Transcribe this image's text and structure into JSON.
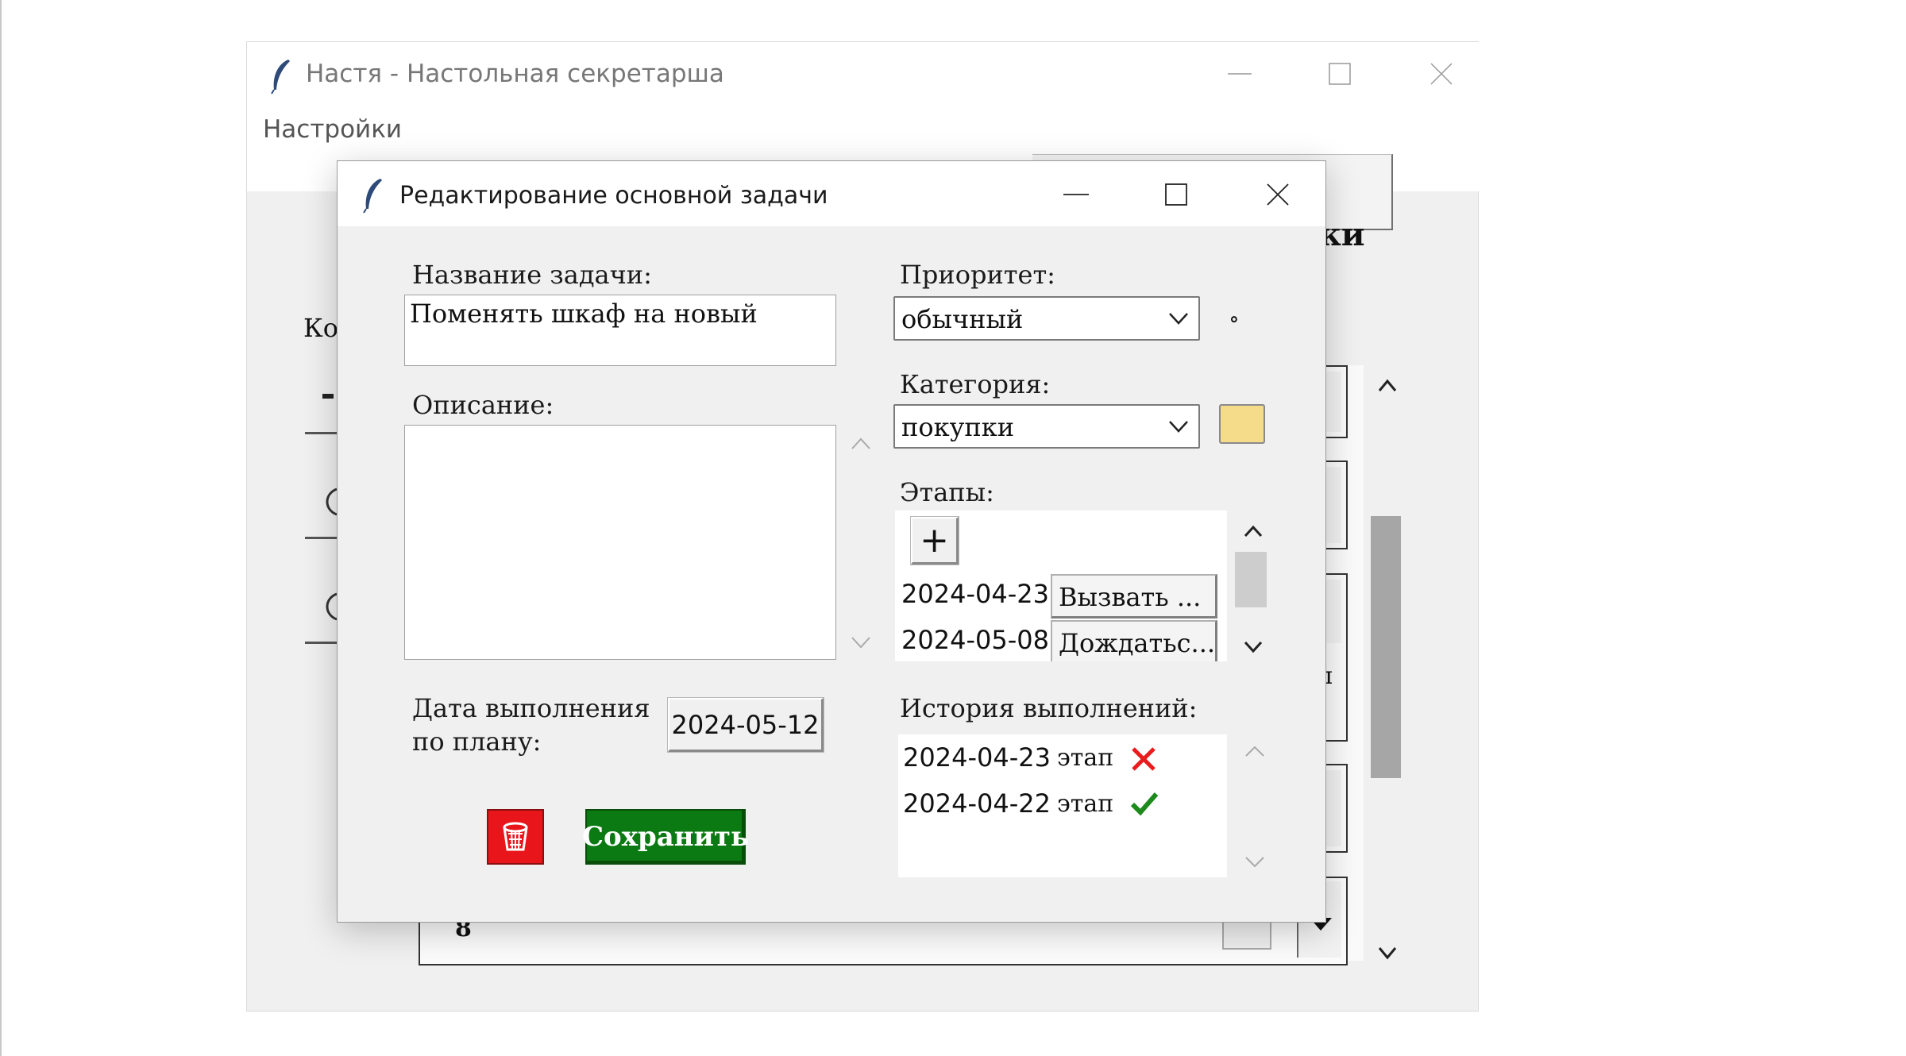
{
  "main_window": {
    "title": "Настя - Настольная секретарша",
    "menu": {
      "settings": "Настройки"
    },
    "background": {
      "button_label_fragment": "ки",
      "label_fragment": "Ко",
      "row_fragment_letter": "л",
      "last_row_number": "8"
    }
  },
  "dialog": {
    "title": "Редактирование основной задачи",
    "task_name_label": "Название задачи:",
    "task_name_value": "Поменять шкаф на новый",
    "description_label": "Описание:",
    "description_value": "",
    "due_date_label_line1": "Дата выполнения",
    "due_date_label_line2": "по плану:",
    "due_date_value": "2024-05-12",
    "priority_label": "Приоритет:",
    "priority_value": "обычный",
    "priority_marker": "∘",
    "category_label": "Категория:",
    "category_value": "покупки",
    "category_color": "#f5dc8a",
    "stages_label": "Этапы:",
    "add_stage_symbol": "+",
    "stages": [
      {
        "date": "2024-04-23",
        "name": "Вызвать ..."
      },
      {
        "date": "2024-05-08",
        "name": "Дождатьс..."
      }
    ],
    "history_label": "История выполнений:",
    "history": [
      {
        "date": "2024-04-23",
        "kind": "этап",
        "status": "cross-icon",
        "status_color": "#e81c1c"
      },
      {
        "date": "2024-04-22",
        "kind": "этап",
        "status": "check-icon",
        "status_color": "#1e8a1e"
      }
    ],
    "save_label": "Сохранить",
    "delete_color": "#e8161b",
    "save_color": "#0b7a12"
  }
}
